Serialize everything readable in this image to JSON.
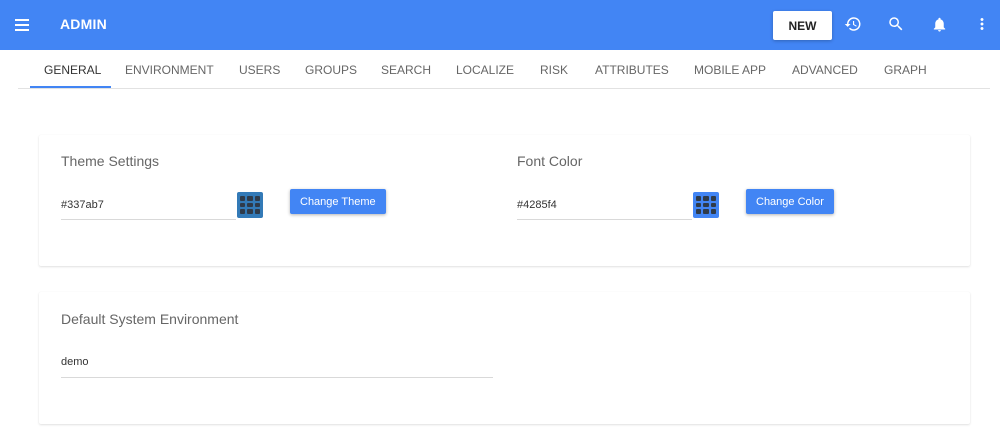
{
  "header": {
    "title": "ADMIN",
    "new_label": "NEW",
    "icons": [
      "menu-icon",
      "history-icon",
      "search-icon",
      "bell-icon",
      "more-vert-icon"
    ],
    "color": "#4285f4"
  },
  "tabs": [
    {
      "label": "GENERAL",
      "active": true
    },
    {
      "label": "ENVIRONMENT"
    },
    {
      "label": "USERS"
    },
    {
      "label": "GROUPS"
    },
    {
      "label": "SEARCH"
    },
    {
      "label": "LOCALIZE"
    },
    {
      "label": "RISK"
    },
    {
      "label": "ATTRIBUTES"
    },
    {
      "label": "MOBILE APP"
    },
    {
      "label": "ADVANCED"
    },
    {
      "label": "GRAPH"
    }
  ],
  "theme_settings": {
    "title": "Theme Settings",
    "value": "#337ab7",
    "button_label": "Change Theme",
    "swatch_color": "#337ab7"
  },
  "font_color": {
    "title": "Font Color",
    "value": "#4285f4",
    "button_label": "Change Color",
    "swatch_color": "#4285f4"
  },
  "default_environment": {
    "title": "Default System Environment",
    "value": "demo"
  }
}
